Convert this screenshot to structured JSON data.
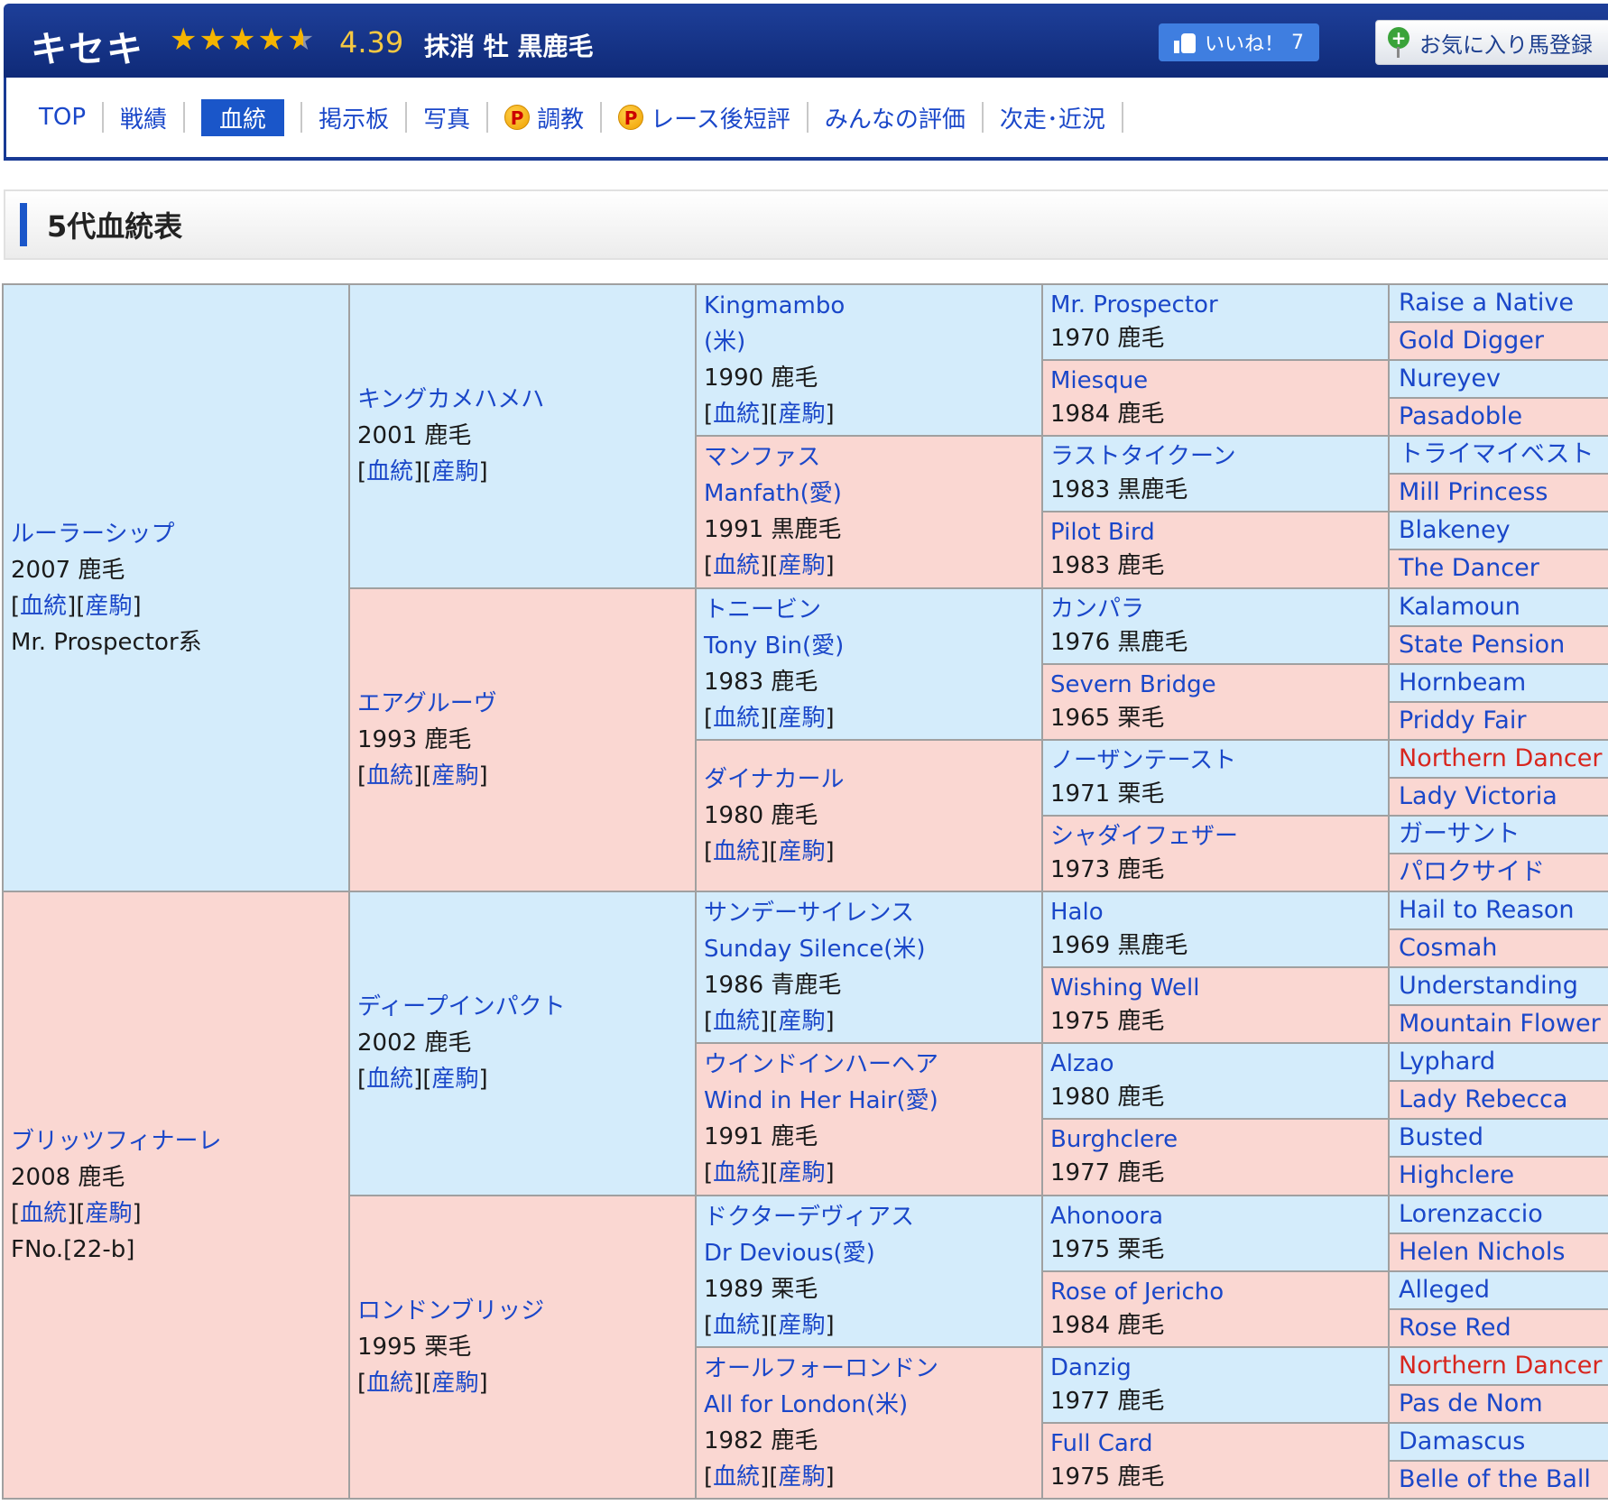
{
  "header": {
    "horse_name": "キセキ",
    "rating": "4.39",
    "status": "抹消 牡 黒鹿毛",
    "like_label": "いいね！",
    "like_count": "7",
    "fav_label": "お気に入り馬登録"
  },
  "nav": {
    "top": "TOP",
    "results": "戦績",
    "pedigree": "血統",
    "board": "掲示板",
    "photos": "写真",
    "training": "調教",
    "review": "レース後短評",
    "ratings": "みんなの評価",
    "next": "次走･近況"
  },
  "section": {
    "title": "5代血統表"
  },
  "links": {
    "pedigree": "血統",
    "progeny": "産駒"
  },
  "gen1": [
    {
      "name": "ルーラーシップ",
      "info": "2007 鹿毛",
      "extra": "Mr. Prospector系"
    },
    {
      "name": "ブリッツフィナーレ",
      "info": "2008 鹿毛",
      "extra": "FNo.[22-b]"
    }
  ],
  "gen2": [
    {
      "name": "キングカメハメハ",
      "info": "2001 鹿毛"
    },
    {
      "name": "エアグルーヴ",
      "info": "1993 鹿毛"
    },
    {
      "name": "ディープインパクト",
      "info": "2002 鹿毛"
    },
    {
      "name": "ロンドンブリッジ",
      "info": "1995 栗毛"
    }
  ],
  "gen3": [
    {
      "name": "Kingmambo",
      "name2": "(米)",
      "info": "1990 鹿毛"
    },
    {
      "name": "マンファス",
      "name2": "Manfath(愛)",
      "info": "1991 黒鹿毛"
    },
    {
      "name": "トニービン",
      "name2": "Tony Bin(愛)",
      "info": "1983 鹿毛"
    },
    {
      "name": "ダイナカール",
      "name2": "",
      "info": "1980 鹿毛"
    },
    {
      "name": "サンデーサイレンス",
      "name2": "Sunday Silence(米)",
      "info": "1986 青鹿毛"
    },
    {
      "name": "ウインドインハーヘア",
      "name2": "Wind in Her Hair(愛)",
      "info": "1991 鹿毛"
    },
    {
      "name": "ドクターデヴィアス",
      "name2": "Dr Devious(愛)",
      "info": "1989 栗毛"
    },
    {
      "name": "オールフォーロンドン",
      "name2": "All for London(米)",
      "info": "1982 鹿毛"
    }
  ],
  "gen4": [
    {
      "name": "Mr. Prospector",
      "info": "1970 鹿毛"
    },
    {
      "name": "Miesque",
      "info": "1984 鹿毛"
    },
    {
      "name": "ラストタイクーン",
      "info": "1983 黒鹿毛"
    },
    {
      "name": "Pilot Bird",
      "info": "1983 鹿毛"
    },
    {
      "name": "カンパラ",
      "info": "1976 黒鹿毛"
    },
    {
      "name": "Severn Bridge",
      "info": "1965 栗毛"
    },
    {
      "name": "ノーザンテースト",
      "info": "1971 栗毛"
    },
    {
      "name": "シャダイフェザー",
      "info": "1973 鹿毛"
    },
    {
      "name": "Halo",
      "info": "1969 黒鹿毛"
    },
    {
      "name": "Wishing Well",
      "info": "1975 鹿毛"
    },
    {
      "name": "Alzao",
      "info": "1980 鹿毛"
    },
    {
      "name": "Burghclere",
      "info": "1977 鹿毛"
    },
    {
      "name": "Ahonoora",
      "info": "1975 栗毛"
    },
    {
      "name": "Rose of Jericho",
      "info": "1984 鹿毛"
    },
    {
      "name": "Danzig",
      "info": "1977 鹿毛"
    },
    {
      "name": "Full Card",
      "info": "1975 鹿毛"
    }
  ],
  "gen5": [
    "Raise a Native",
    "Gold Digger",
    "Nureyev",
    "Pasadoble",
    "トライマイベスト",
    "Mill Princess",
    "Blakeney",
    "The Dancer",
    "Kalamoun",
    "State Pension",
    "Hornbeam",
    "Priddy Fair",
    "Northern Dancer",
    "Lady Victoria",
    "ガーサント",
    "パロクサイド",
    "Hail to Reason",
    "Cosmah",
    "Understanding",
    "Mountain Flower",
    "Lyphard",
    "Lady Rebecca",
    "Busted",
    "Highclere",
    "Lorenzaccio",
    "Helen Nichols",
    "Alleged",
    "Rose Red",
    "Northern Dancer",
    "Pas de Nom",
    "Damascus",
    "Belle of the Ball"
  ],
  "colors": {
    "male_bg": "#d4ecfb",
    "female_bg": "#fad7d2",
    "link": "#1a47c9",
    "inbreed": "#d8261e",
    "header": "#15348a"
  }
}
